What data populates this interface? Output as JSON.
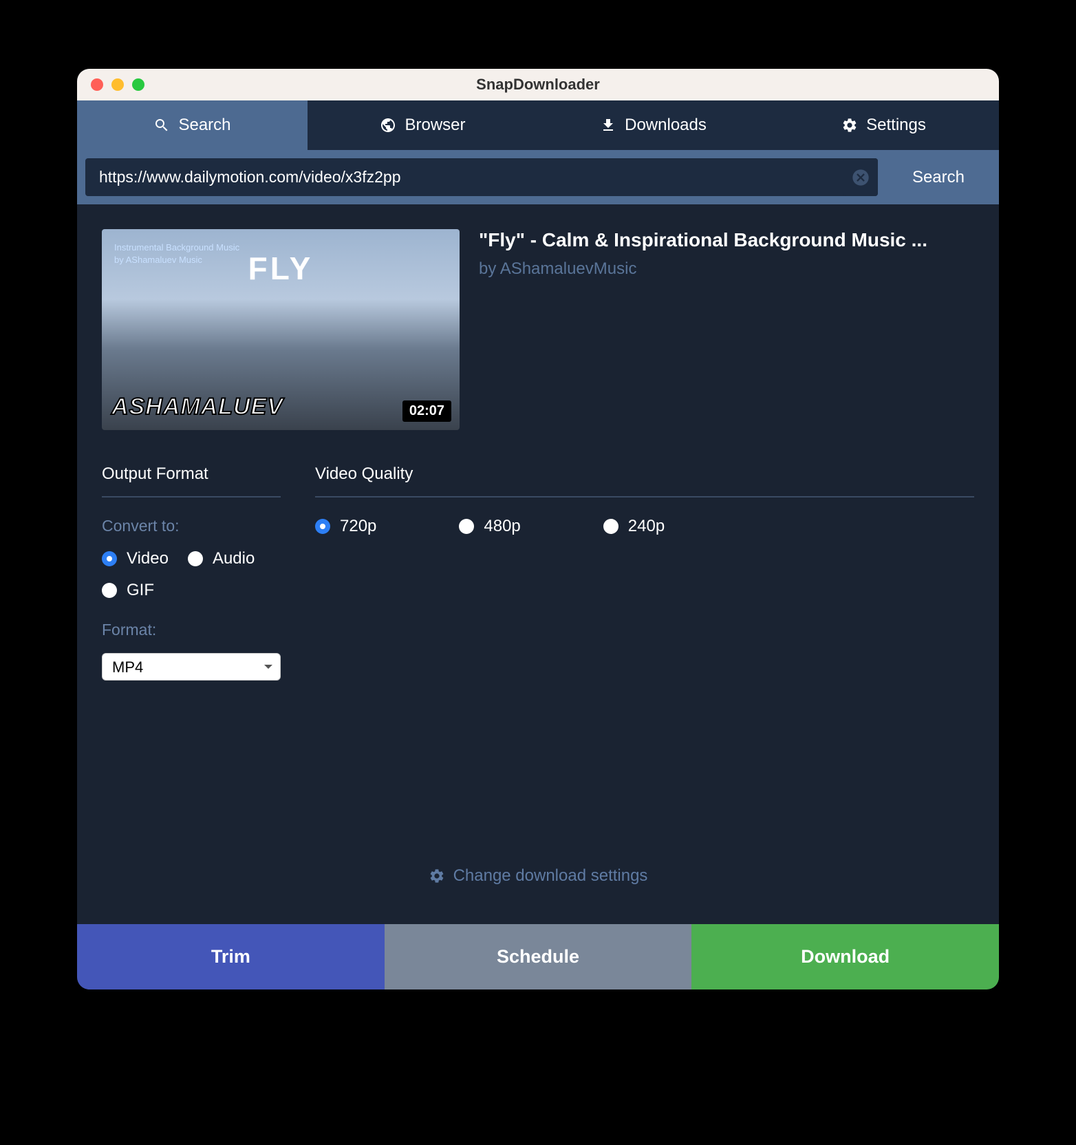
{
  "window": {
    "title": "SnapDownloader"
  },
  "tabs": {
    "search": "Search",
    "browser": "Browser",
    "downloads": "Downloads",
    "settings": "Settings"
  },
  "search": {
    "value": "https://www.dailymotion.com/video/x3fz2pp",
    "button": "Search"
  },
  "video": {
    "title": "\"Fly\" - Calm & Inspirational Background Music ...",
    "author": "by AShamaluevMusic",
    "duration": "02:07",
    "thumb_caption1": "Instrumental Background Music",
    "thumb_caption2": "by AShamaluev Music",
    "thumb_title": "FLY",
    "thumb_badge": "ASHAMALUEV"
  },
  "output": {
    "header": "Output Format",
    "convert_label": "Convert to:",
    "options": {
      "video": "Video",
      "audio": "Audio",
      "gif": "GIF"
    },
    "selected": "video",
    "format_label": "Format:",
    "format_value": "MP4"
  },
  "quality": {
    "header": "Video Quality",
    "options": {
      "q720": "720p",
      "q480": "480p",
      "q240": "240p"
    },
    "selected": "q720"
  },
  "change_settings": "Change download settings",
  "actions": {
    "trim": "Trim",
    "schedule": "Schedule",
    "download": "Download"
  }
}
